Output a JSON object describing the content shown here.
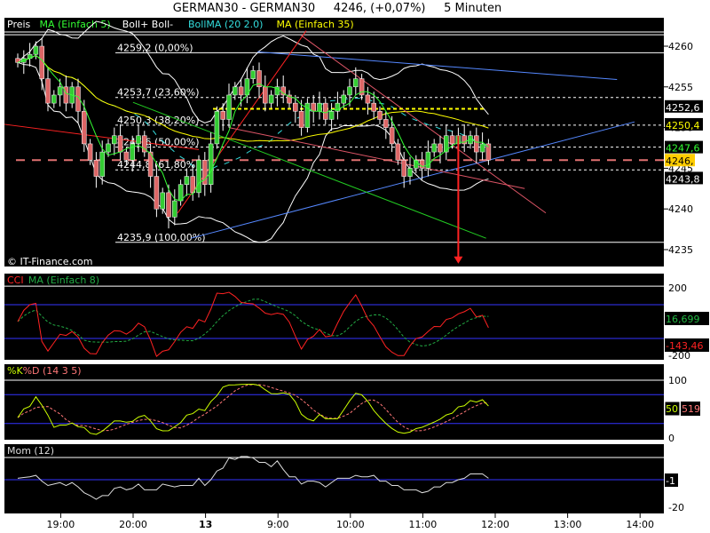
{
  "header": {
    "title": "GERMAN30 - GERMAN30     4246, (+0,07%)     5 Minuten"
  },
  "main_legend": [
    {
      "text": "Preis",
      "color": "#ffffff"
    },
    {
      "text": "MA (Einfach 5)",
      "color": "#33ff33"
    },
    {
      "text": "Boll+ Boll-",
      "color": "#ffffff"
    },
    {
      "text": "BollMA (20 2.0)",
      "color": "#33dddd"
    },
    {
      "text": "MA (Einfach 35)",
      "color": "#ffff00"
    }
  ],
  "watermark": "© IT-Finance.com",
  "colors": {
    "up": "#33cc33",
    "down": "#dd6666",
    "panel": "#000000"
  },
  "chart_data": {
    "type": "candlestick",
    "price_axis": {
      "ticks": [
        4235,
        4240,
        4245,
        4250,
        4255,
        4260
      ],
      "ylim": [
        4233,
        4262.5
      ]
    },
    "time_ticks": [
      {
        "label": "19:00",
        "index": 8
      },
      {
        "label": "20:00",
        "index": 20
      },
      {
        "label": "13",
        "index": 32
      },
      {
        "label": "9:00",
        "index": 44
      },
      {
        "label": "10:00",
        "index": 56
      },
      {
        "label": "11:00",
        "index": 68
      },
      {
        "label": "12:00",
        "index": 80
      },
      {
        "label": "13:00",
        "index": 92
      },
      {
        "label": "14:00",
        "index": 104
      }
    ],
    "closes": [
      4258,
      4258.5,
      4259,
      4260,
      4256,
      4253,
      4254,
      4255,
      4253,
      4255,
      4252,
      4248,
      4246,
      4244,
      4247,
      4248,
      4249,
      4247,
      4246,
      4248,
      4249,
      4247,
      4244,
      4240,
      4242,
      4239,
      4241,
      4243,
      4244,
      4242,
      4246,
      4243,
      4248,
      4252,
      4251,
      4254,
      4255,
      4254,
      4256,
      4257,
      4255,
      4253,
      4254,
      4255,
      4254,
      4253,
      4252,
      4250,
      4253,
      4252,
      4253,
      4251,
      4252,
      4253,
      4254,
      4255,
      4256,
      4254,
      4253,
      4252,
      4251,
      4250,
      4248,
      4246,
      4244,
      4245,
      4246,
      4245,
      4247,
      4248,
      4247,
      4249,
      4248,
      4249,
      4248,
      4249,
      4247,
      4248,
      4246
    ],
    "fibonacci": [
      {
        "label": "4259,2 (0,00%)",
        "price": 4259.2,
        "style": "solid"
      },
      {
        "label": "4253,7 (23,60%)",
        "price": 4253.7,
        "style": "dash"
      },
      {
        "label": "4250,3 (38,20%)",
        "price": 4250.3,
        "style": "dash"
      },
      {
        "label": "4247,6 (50,00%)",
        "price": 4247.6,
        "style": "dash"
      },
      {
        "label": "4244,8 (61,80%)",
        "price": 4244.8,
        "style": "dash"
      },
      {
        "label": "4235,9 (100,00%)",
        "price": 4235.9,
        "style": "solid"
      }
    ],
    "trendlines": [
      {
        "color": "#5588ff",
        "from": [
          39.7,
          4259.3
        ],
        "to": [
          99.3,
          4255.9
        ]
      },
      {
        "color": "#5588ff",
        "from": [
          28.7,
          4236.4
        ],
        "to": [
          102.2,
          4250.7
        ]
      },
      {
        "color": "#ff2222",
        "from": [
          26.5,
          4239.5
        ],
        "to": [
          47.8,
          4261.9
        ]
      },
      {
        "color": "#ff2222",
        "from": [
          -2.2,
          4250.4
        ],
        "to": [
          30,
          4247.3
        ]
      },
      {
        "color": "#dd5566",
        "from": [
          47,
          4261.3
        ],
        "to": [
          87.5,
          4239.5
        ]
      },
      {
        "color": "#dd5566",
        "from": [
          35,
          4250
        ],
        "to": [
          84,
          4242.5
        ]
      },
      {
        "color": "#22cc22",
        "from": [
          19.1,
          4253.1
        ],
        "to": [
          77.6,
          4236.4
        ]
      }
    ],
    "current_price_line": 4246,
    "yellow_level": 4252.3,
    "arrow": {
      "index": 73,
      "from": 4249,
      "to": 4233.5,
      "color": "#ff2222"
    },
    "price_labels": [
      {
        "text": "4252,6",
        "price": 4252.6,
        "color": "#ffffff",
        "bg": "#000000"
      },
      {
        "text": "4250,4",
        "price": 4250.4,
        "color": "#ffff00",
        "bg": "#000000"
      },
      {
        "text": "4247,6",
        "price": 4247.6,
        "color": "#33ff33",
        "bg": "#000000"
      },
      {
        "text": "4246,",
        "price": 4246,
        "color": "#000000",
        "bg": "#ffcc00"
      },
      {
        "text": "4243,8",
        "price": 4243.8,
        "color": "#ffffff",
        "bg": "#000000"
      }
    ]
  },
  "cci": {
    "legend": [
      {
        "text": "CCI",
        "color": "#ff2222"
      },
      {
        "text": "MA (Einfach 8)",
        "color": "#22aa44"
      }
    ],
    "ticks": [
      "200",
      "-200"
    ],
    "values": [
      {
        "text": "16,699",
        "color": "#22bb44"
      },
      {
        "text": "-143,46",
        "color": "#ff2222"
      }
    ]
  },
  "stoch": {
    "legend": [
      {
        "text": "%K",
        "color": "#ccff00"
      },
      {
        "text": "%D (14 3 5)",
        "color": "#ff7777"
      }
    ],
    "ticks": [
      "100",
      "50",
      "0"
    ],
    "values": [
      {
        "text": "50",
        "color": "#ccff00"
      },
      {
        "text": "519",
        "color": "#ff7777"
      }
    ]
  },
  "mom": {
    "legend": [
      {
        "text": "Mom (12)",
        "color": "#dddddd"
      }
    ],
    "ticks": [
      "-1",
      "-20"
    ]
  }
}
